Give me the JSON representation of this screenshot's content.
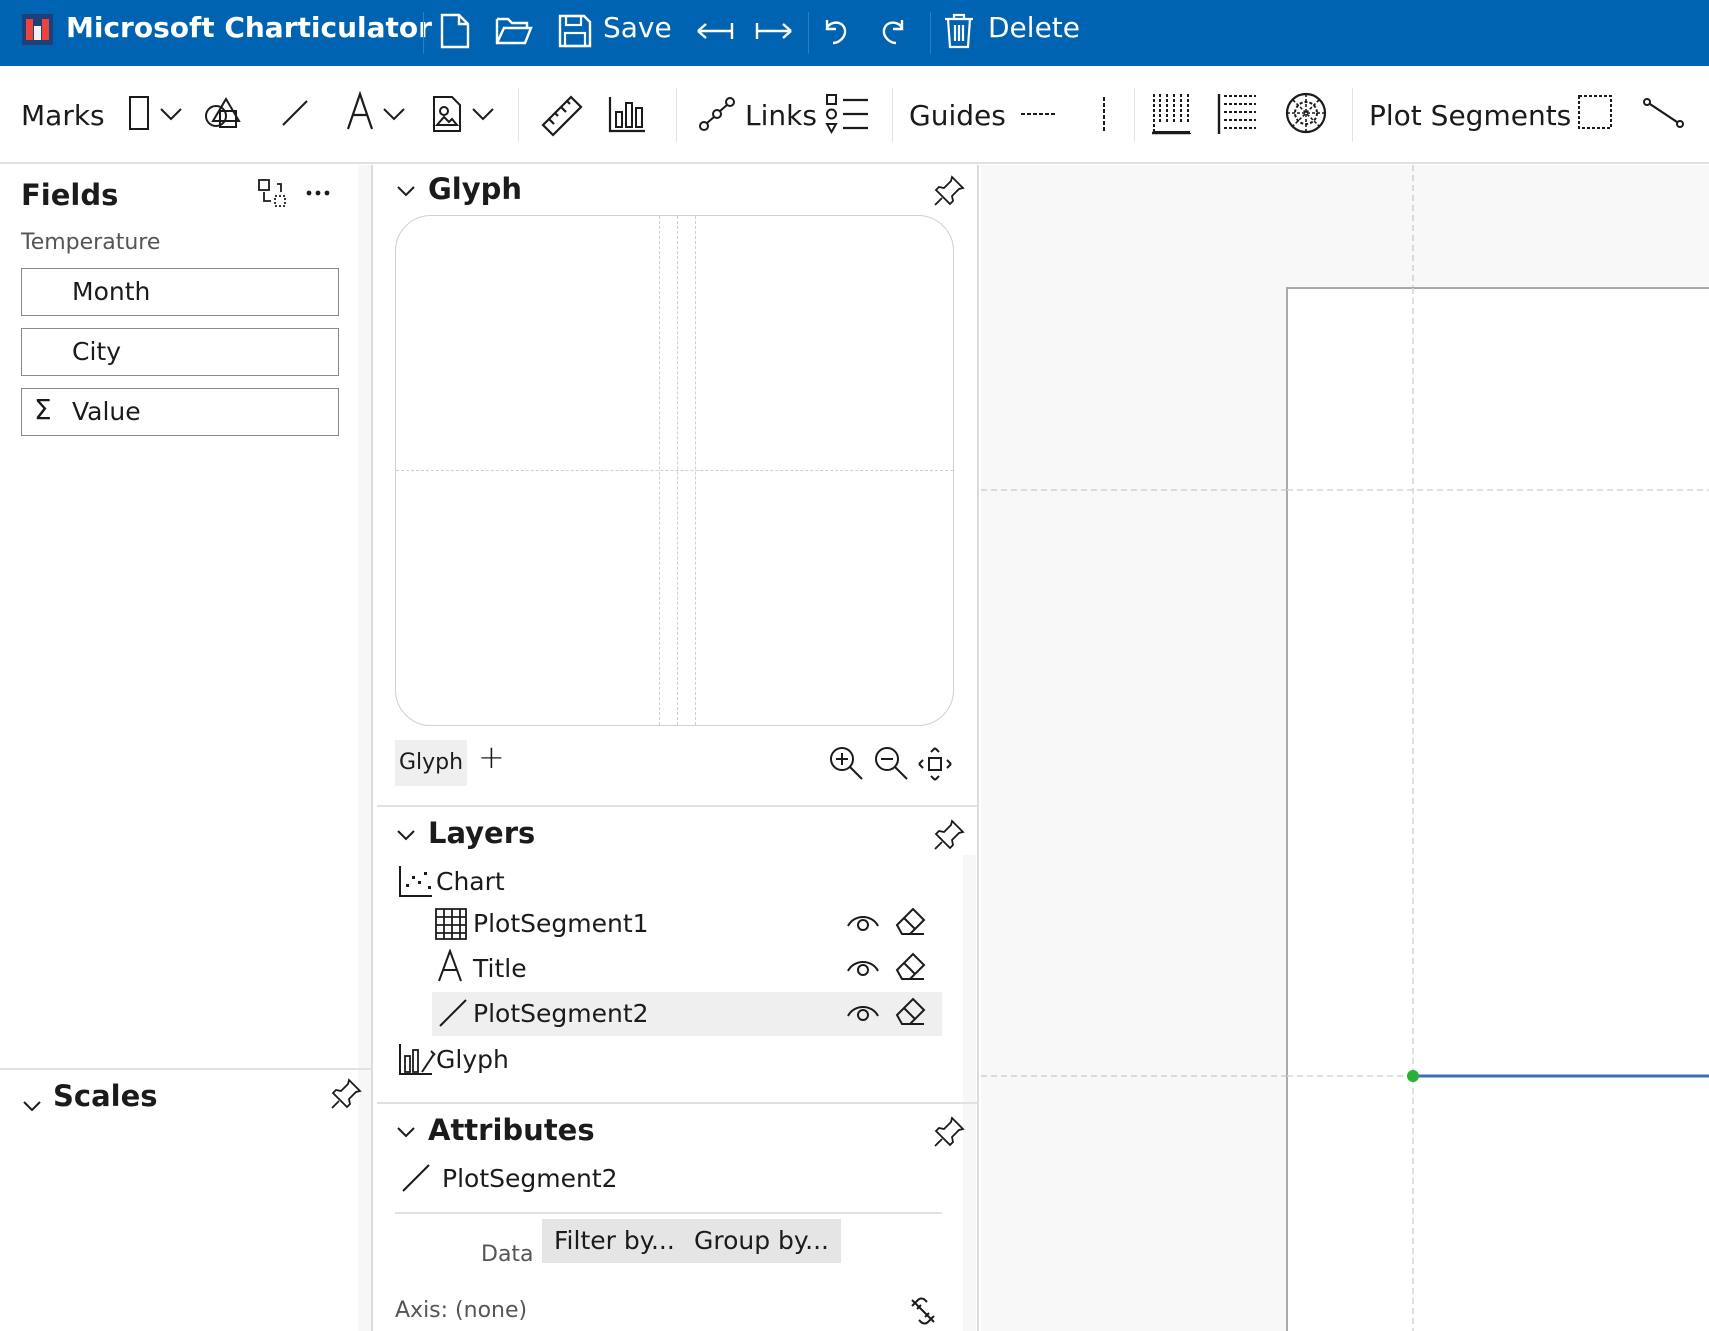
{
  "app": {
    "title": "Microsoft Charticulator",
    "save_label": "Save",
    "delete_label": "Delete",
    "colors": {
      "titlebar": "#0063b1",
      "accent": "#3c6eb4",
      "handle": "#2ab03a"
    }
  },
  "toolbar": {
    "marks_label": "Marks",
    "links_label": "Links",
    "guides_label": "Guides",
    "plot_segments_label": "Plot Segments",
    "icons": [
      "rectangle-icon",
      "shapes-icon",
      "line-icon",
      "text-icon",
      "image-icon",
      "ruler-icon",
      "data-axis-icon",
      "links-icon",
      "legend-icon",
      "guide-horizontal-icon",
      "guide-vertical-icon",
      "grid-icon",
      "grid-dashed-icon",
      "polar-icon",
      "plot-segment-icon",
      "line-segment-icon"
    ]
  },
  "fields": {
    "title": "Fields",
    "dataset_name": "Temperature",
    "items": [
      {
        "label": "Month",
        "type": "categorical"
      },
      {
        "label": "City",
        "type": "categorical"
      },
      {
        "label": "Value",
        "type": "numerical",
        "prefix": "Σ"
      }
    ]
  },
  "scales": {
    "title": "Scales"
  },
  "glyph_panel": {
    "title": "Glyph",
    "tab_label": "Glyph",
    "add_label": "+"
  },
  "layers": {
    "title": "Layers",
    "root": "Chart",
    "items": [
      {
        "label": "PlotSegment1",
        "icon": "table-icon"
      },
      {
        "label": "Title",
        "icon": "text-icon"
      },
      {
        "label": "PlotSegment2",
        "icon": "line-icon",
        "selected": true
      }
    ],
    "glyph_label": "Glyph"
  },
  "attributes": {
    "title": "Attributes",
    "selected_name": "PlotSegment2",
    "data_label": "Data",
    "filter_label": "Filter by...",
    "group_label": "Group by...",
    "axis_label": "Axis: (none)"
  }
}
